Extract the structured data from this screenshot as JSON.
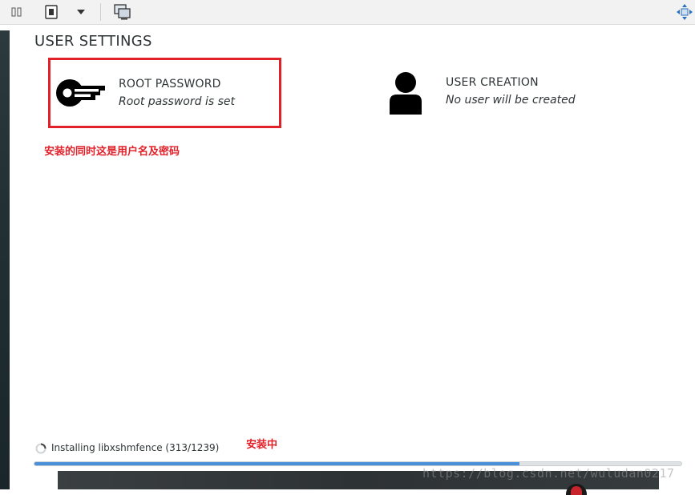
{
  "section": {
    "title": "USER SETTINGS"
  },
  "root_spoke": {
    "name": "ROOT PASSWORD",
    "status": "Root password is set",
    "icon": "key-icon"
  },
  "user_spoke": {
    "name": "USER CREATION",
    "status": "No user will be created",
    "icon": "user-icon"
  },
  "annotations": {
    "root_note": "安装的同时这是用户名及密码",
    "installing_note": "安装中"
  },
  "progress": {
    "label": "Installing libxshmfence (313/1239)",
    "fraction": 0.75
  },
  "watermark": "https://blog.csdn.net/wuludan0217",
  "toolbar": {
    "icons": [
      "pause-icon",
      "screen-icon",
      "dropdown-arrow-icon",
      "console-icon",
      "fit-window-icon"
    ]
  },
  "colors": {
    "annotation": "#e0212a",
    "progress": "#4a90d9"
  }
}
